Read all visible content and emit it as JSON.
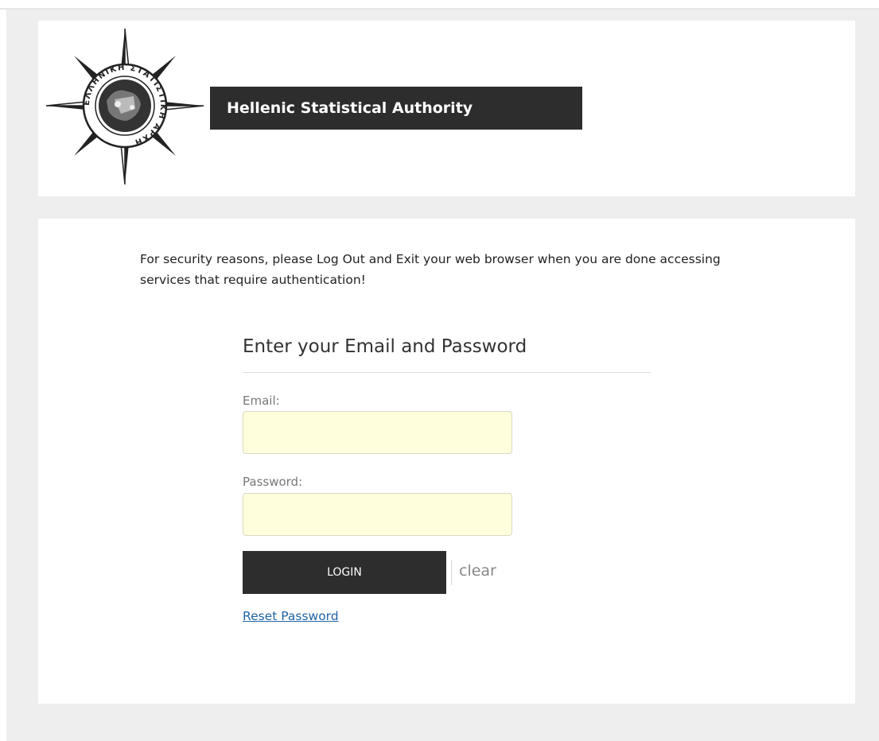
{
  "header": {
    "title": "Hellenic Statistical Authority",
    "logo_icon": "compass-rose-emblem-icon",
    "logo_text": "ΕΛΛΗΝΙΚΗ ΣΤΑΤΙΣΤΙΚΗ ΑΡΧΗ"
  },
  "notice": {
    "text": "For security reasons, please Log Out and Exit your web browser when you are done accessing services that require authentication!"
  },
  "login_form": {
    "heading": "Enter your Email and Password",
    "email_label": "Email:",
    "email_value": "",
    "password_label": "Password:",
    "password_value": "",
    "login_label": "LOGIN",
    "clear_label": "clear",
    "reset_label": "Reset Password"
  },
  "colors": {
    "page_background": "#eeeeee",
    "panel_background": "#ffffff",
    "title_bar": "#2d2d2d",
    "input_background": "#fffedc",
    "link": "#1f63a6"
  }
}
